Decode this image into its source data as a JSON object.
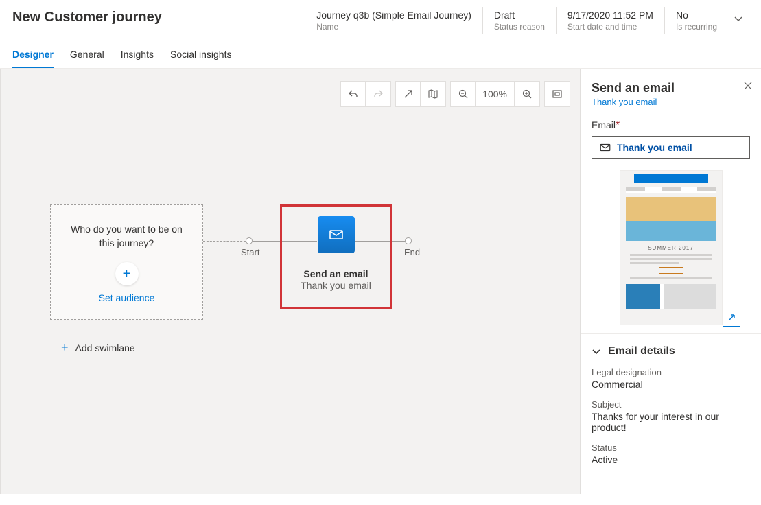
{
  "header": {
    "title": "New Customer journey",
    "meta": [
      {
        "value": "Journey q3b (Simple Email Journey)",
        "label": "Name"
      },
      {
        "value": "Draft",
        "label": "Status reason"
      },
      {
        "value": "9/17/2020 11:52 PM",
        "label": "Start date and time"
      },
      {
        "value": "No",
        "label": "Is recurring"
      }
    ]
  },
  "tabs": [
    "Designer",
    "General",
    "Insights",
    "Social insights"
  ],
  "toolbar": {
    "zoom": "100%"
  },
  "canvas": {
    "audience": {
      "prompt": "Who do you want to be on this journey?",
      "link": "Set audience"
    },
    "start_label": "Start",
    "end_label": "End",
    "email_tile": {
      "title": "Send an email",
      "subtitle": "Thank you email"
    },
    "add_swimlane": "Add swimlane",
    "preview_heading": "SUMMER 2017"
  },
  "panel": {
    "title": "Send an email",
    "subtitle": "Thank you email",
    "email_label": "Email",
    "email_value": "Thank you email",
    "details_heading": "Email details",
    "details": [
      {
        "k": "Legal designation",
        "v": "Commercial"
      },
      {
        "k": "Subject",
        "v": "Thanks for your interest in our product!"
      },
      {
        "k": "Status",
        "v": "Active"
      }
    ]
  }
}
